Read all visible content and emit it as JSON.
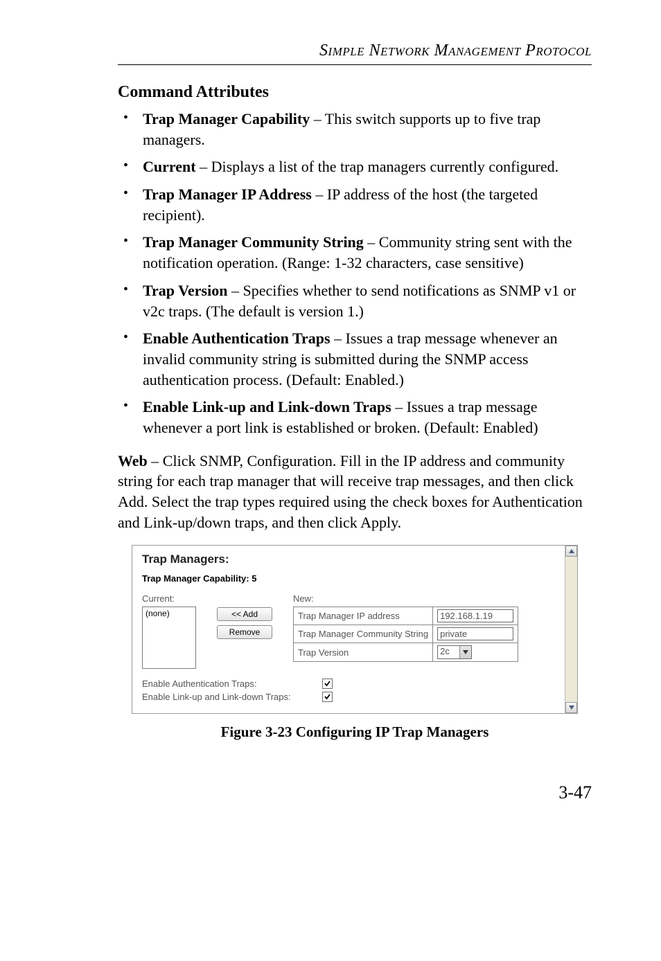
{
  "running_head": "Simple Network Management Protocol",
  "section_title": "Command Attributes",
  "bullets": [
    {
      "term": "Trap Manager Capability",
      "desc": " – This switch supports up to five trap managers."
    },
    {
      "term": "Current",
      "desc": " – Displays a list of the trap managers currently configured."
    },
    {
      "term": "Trap Manager IP Address",
      "desc": " – IP address of the host (the targeted recipient)."
    },
    {
      "term": "Trap Manager Community String",
      "desc": " – Community string sent with the notification operation. (Range: 1-32 characters, case sensitive)"
    },
    {
      "term": "Trap Version",
      "desc": " – Specifies whether to send notifications as SNMP v1 or v2c traps. (The default is version 1.)"
    },
    {
      "term": "Enable Authentication Traps",
      "desc": " – Issues a trap message whenever an invalid community string is submitted during the SNMP access authentication process. (Default: Enabled.)"
    },
    {
      "term": "Enable Link-up and Link-down Traps",
      "desc": " – Issues a trap message whenever a port link is established or broken. (Default: Enabled)"
    }
  ],
  "web_para_lead": "Web",
  "web_para_rest": " – Click SNMP, Configuration. Fill in the IP address and community string for each trap manager that will receive trap messages, and then click Add. Select the trap types required using the check boxes for Authentication and Link-up/down traps, and then click Apply.",
  "screenshot": {
    "title": "Trap Managers:",
    "capability_label": "Trap Manager Capability: 5",
    "current_label": "Current:",
    "current_value": "(none)",
    "new_label": "New:",
    "btn_add": "<< Add",
    "btn_remove": "Remove",
    "rows": {
      "ip_label": "Trap Manager IP address",
      "ip_value": "192.168.1.19",
      "comm_label": "Trap Manager Community String",
      "comm_value": "private",
      "ver_label": "Trap Version",
      "ver_value": "2c"
    },
    "check_auth_label": "Enable Authentication Traps:",
    "check_link_label": "Enable Link-up and Link-down Traps:"
  },
  "figure_caption": "Figure 3-23  Configuring IP Trap Managers",
  "page_number": "3-47"
}
